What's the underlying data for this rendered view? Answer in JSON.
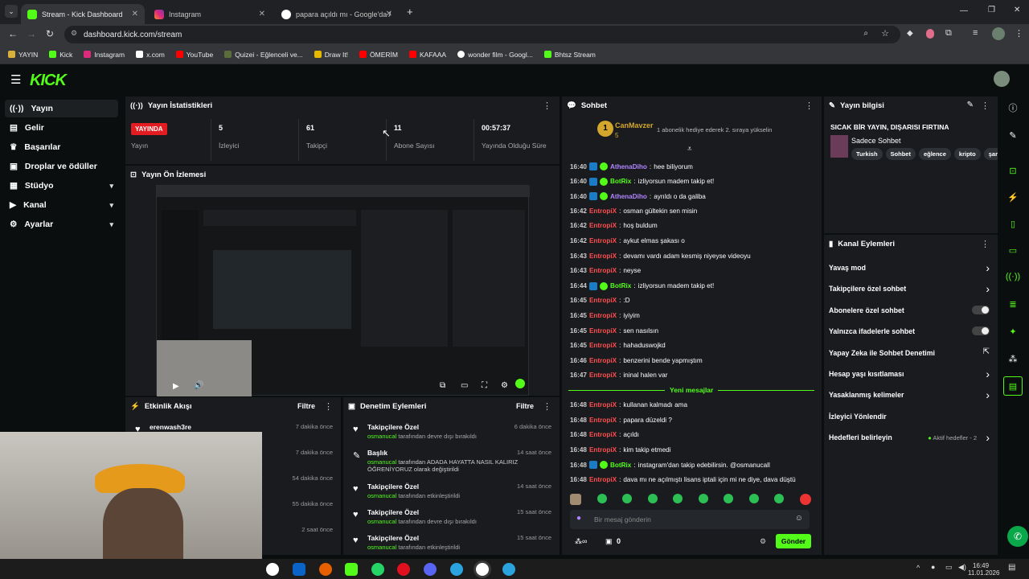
{
  "browser": {
    "tabs": [
      {
        "label": "Stream - Kick Dashboard",
        "active": true
      },
      {
        "label": "Instagram",
        "active": false
      },
      {
        "label": "papara açıldı mı - Google'da A",
        "active": false
      }
    ],
    "url": "dashboard.kick.com/stream",
    "bookmarks": [
      "YAYIN",
      "Kick",
      "Instagram",
      "x.com",
      "YouTube",
      "Quizei - Eğlenceli ve...",
      "Draw It!",
      "ÖMERİM",
      "KAFAAA",
      "wonder film - Googl...",
      "Bhtsz Stream"
    ]
  },
  "sidebar": {
    "items": [
      {
        "label": "Yayın",
        "icon": "broadcast-icon",
        "active": true
      },
      {
        "label": "Gelir",
        "icon": "revenue-icon"
      },
      {
        "label": "Başarılar",
        "icon": "trophy-icon"
      },
      {
        "label": "Droplar ve ödüller",
        "icon": "gift-icon"
      },
      {
        "label": "Stüdyo",
        "icon": "studio-icon",
        "expandable": true
      },
      {
        "label": "Kanal",
        "icon": "channel-icon",
        "expandable": true
      },
      {
        "label": "Ayarlar",
        "icon": "gear-icon",
        "expandable": true
      }
    ]
  },
  "stats": {
    "title": "Yayın İstatistikleri",
    "live_badge": "YAYINDA",
    "live_label": "Yayın",
    "viewers": "5",
    "viewers_label": "İzleyici",
    "followers": "61",
    "followers_label": "Takipçi",
    "subs": "11",
    "subs_label": "Abone Sayısı",
    "duration": "00:57:37",
    "duration_label": "Yayında Olduğu Süre"
  },
  "preview": {
    "title": "Yayın Ön İzlemesi"
  },
  "activity": {
    "title": "Etkinlik Akışı",
    "filter": "Filtre",
    "items": [
      {
        "name": "erenwash3re",
        "time": "7 dakika önce"
      },
      {
        "name": "",
        "time": "7 dakika önce"
      },
      {
        "name": "",
        "time": "54 dakika önce"
      },
      {
        "name": "",
        "time": "55 dakika önce"
      },
      {
        "name": "",
        "time": "2 saat önce"
      }
    ]
  },
  "moderation": {
    "title": "Denetim Eylemleri",
    "filter": "Filtre",
    "items": [
      {
        "title": "Takipçilere Özel",
        "user": "osmanucal",
        "action": "tarafından devre dışı bırakıldı",
        "time": "6 dakika önce"
      },
      {
        "title": "Başlık",
        "user": "osmanucal",
        "action": "tarafından ADADA HAYATTA NASIL KALIRIZ ÖĞRENİYORUZ olarak değiştirildi",
        "time": "14 saat önce"
      },
      {
        "title": "Takipçilere Özel",
        "user": "osmanucal",
        "action": "tarafından etkinleştirildi",
        "time": "14 saat önce"
      },
      {
        "title": "Takipçilere Özel",
        "user": "osmanucal",
        "action": "tarafından devre dışı bırakıldı",
        "time": "15 saat önce"
      },
      {
        "title": "Takipçilere Özel",
        "user": "osmanucal",
        "action": "tarafından etkinleştirildi",
        "time": "15 saat önce"
      }
    ]
  },
  "chat": {
    "title": "Sohbet",
    "pinned_user": "CanMavzer",
    "pinned_count": "5",
    "pinned_text": "1 abonelik hediye ederek 2. sıraya yükselin",
    "new_messages": "Yeni mesajlar",
    "messages": [
      {
        "time": "16:40",
        "user": "AthenaDiho",
        "c": "u1",
        "badges": 2,
        "text": "hee biliyorum"
      },
      {
        "time": "16:40",
        "user": "BotRix",
        "c": "u3",
        "badges": 2,
        "text": "izliyorsun madem takip et!"
      },
      {
        "time": "16:40",
        "user": "AthenaDiho",
        "c": "u1",
        "badges": 2,
        "text": "ayrıldı o da galiba"
      },
      {
        "time": "16:42",
        "user": "EntropiX",
        "c": "u2",
        "badges": 0,
        "text": "osman gültekin sen misin"
      },
      {
        "time": "16:42",
        "user": "EntropiX",
        "c": "u2",
        "badges": 0,
        "text": "hoş buldum"
      },
      {
        "time": "16:42",
        "user": "EntropiX",
        "c": "u2",
        "badges": 0,
        "text": "aykut elmas şakası o"
      },
      {
        "time": "16:43",
        "user": "EntropiX",
        "c": "u2",
        "badges": 0,
        "text": "devamı vardı adam kesmiş niyeyse videoyu"
      },
      {
        "time": "16:43",
        "user": "EntropiX",
        "c": "u2",
        "badges": 0,
        "text": "neyse"
      },
      {
        "time": "16:44",
        "user": "BotRix",
        "c": "u3",
        "badges": 2,
        "text": "izliyorsun madem takip et!"
      },
      {
        "time": "16:45",
        "user": "EntropiX",
        "c": "u2",
        "badges": 0,
        "text": ":D"
      },
      {
        "time": "16:45",
        "user": "EntropiX",
        "c": "u2",
        "badges": 0,
        "text": "iyiyim"
      },
      {
        "time": "16:45",
        "user": "EntropiX",
        "c": "u2",
        "badges": 0,
        "text": "sen nasılsın"
      },
      {
        "time": "16:45",
        "user": "EntropiX",
        "c": "u2",
        "badges": 0,
        "text": "hahaduswojkd"
      },
      {
        "time": "16:46",
        "user": "EntropiX",
        "c": "u2",
        "badges": 0,
        "text": "benzerini bende yapmıştım"
      },
      {
        "time": "16:47",
        "user": "EntropiX",
        "c": "u2",
        "badges": 0,
        "text": "ininal halen var"
      }
    ],
    "new": [
      {
        "time": "16:48",
        "user": "EntropiX",
        "c": "u2",
        "badges": 0,
        "text": "kullanan kalmadı ama"
      },
      {
        "time": "16:48",
        "user": "EntropiX",
        "c": "u2",
        "badges": 0,
        "text": "papara düzeldi ?"
      },
      {
        "time": "16:48",
        "user": "EntropiX",
        "c": "u2",
        "badges": 0,
        "text": "açıldı"
      },
      {
        "time": "16:48",
        "user": "EntropiX",
        "c": "u2",
        "badges": 0,
        "text": "kim takip etmedi"
      },
      {
        "time": "16:48",
        "user": "BotRix",
        "c": "u3",
        "badges": 2,
        "text": "instagram'dan takip edebilirsin. @osmanucall"
      },
      {
        "time": "16:48",
        "user": "EntropiX",
        "c": "u2",
        "badges": 0,
        "text": "dava mı ne açılmıştı lisans iptali için mi ne diye, dava düştü"
      }
    ],
    "input_placeholder": "Bir mesaj gönderin",
    "points": "0",
    "send": "Gönder"
  },
  "info": {
    "title": "Yayın bilgisi",
    "stream_title": "SICAK BİR YAYIN, DIŞARISI FIRTINA",
    "category": "Sadece Sohbet",
    "tags": [
      "Turkish",
      "Sohbet",
      "eğlence",
      "kripto",
      "şar"
    ]
  },
  "channel_actions": {
    "title": "Kanal Eylemleri",
    "items": [
      {
        "label": "Yavaş mod",
        "kind": "chev"
      },
      {
        "label": "Takipçilere özel sohbet",
        "kind": "chev"
      },
      {
        "label": "Abonelere özel sohbet",
        "kind": "toggle"
      },
      {
        "label": "Yalnızca ifadelerle sohbet",
        "kind": "toggle"
      },
      {
        "label": "Yapay Zeka ile Sohbet Denetimi",
        "kind": "ext"
      },
      {
        "label": "Hesap yaşı kısıtlaması",
        "kind": "chev"
      },
      {
        "label": "Yasaklanmış kelimeler",
        "kind": "chev"
      },
      {
        "label": "İzleyici Yönlendir",
        "kind": "none"
      },
      {
        "label": "Hedefleri belirleyin",
        "kind": "chev"
      }
    ],
    "goals_status": "Aktif hedefler - 2"
  },
  "taskbar": {
    "time": "16:49",
    "date": "11.01.2026"
  },
  "colors": {
    "accent": "#53fc18",
    "live": "#e21c21",
    "panel": "#191b1f"
  }
}
